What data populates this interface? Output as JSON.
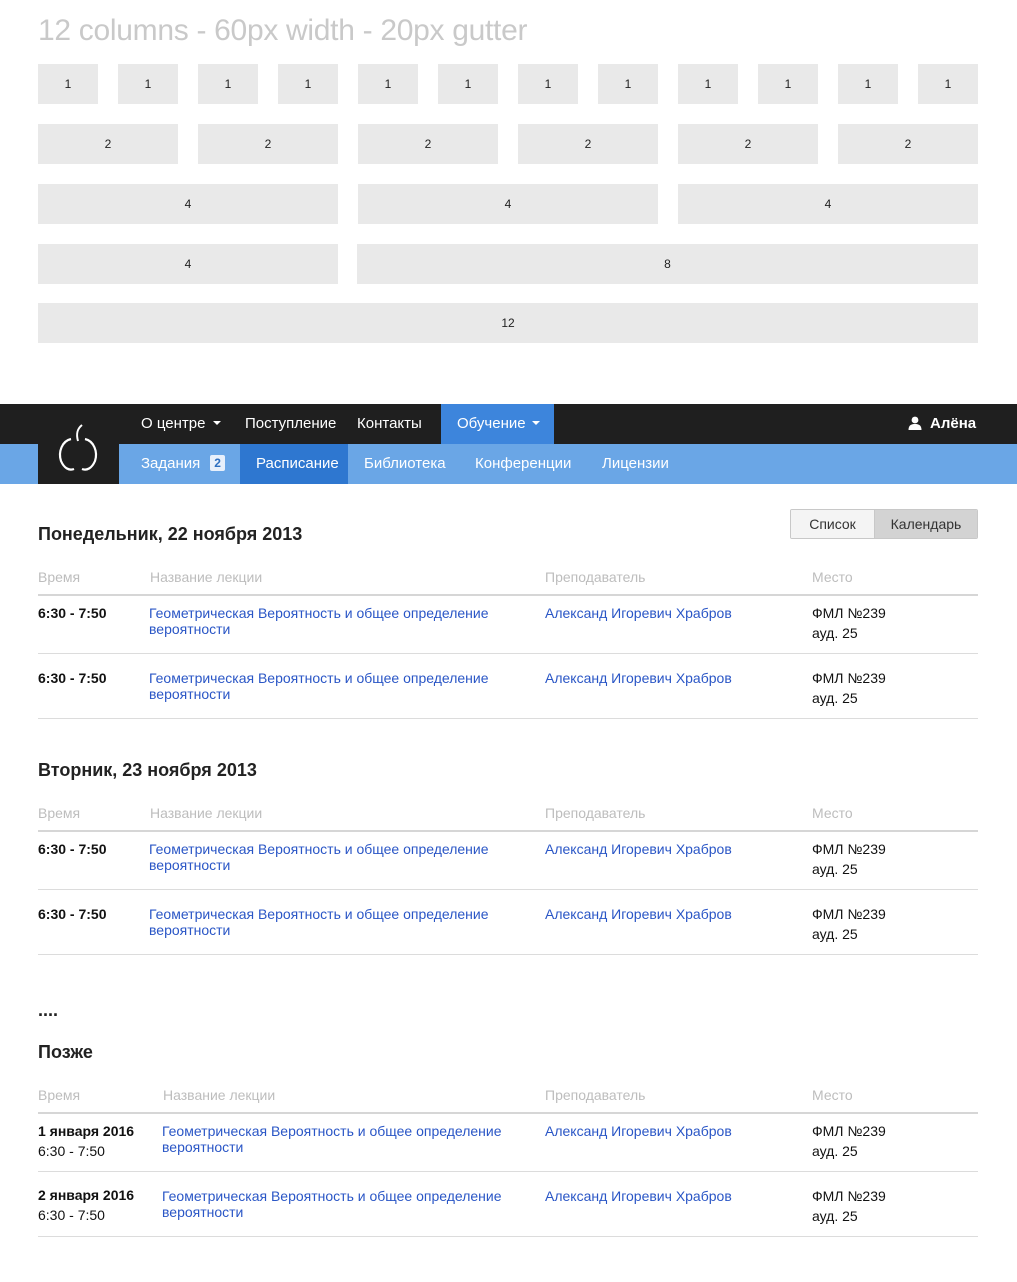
{
  "grid": {
    "title": "12 columns - 60px width - 20px gutter",
    "rows": [
      [
        "1",
        "1",
        "1",
        "1",
        "1",
        "1",
        "1",
        "1",
        "1",
        "1",
        "1",
        "1"
      ],
      [
        "2",
        "2",
        "2",
        "2",
        "2",
        "2"
      ],
      [
        "4",
        "4",
        "4"
      ],
      [
        "4",
        "8"
      ],
      [
        "12"
      ]
    ]
  },
  "nav": {
    "top": [
      "О центре",
      "Поступление",
      "Контакты",
      "Обучение"
    ],
    "user": "Алёна",
    "sub": [
      "Задания",
      "Расписание",
      "Библиотека",
      "Конференции",
      "Лицензии"
    ],
    "badge": "2",
    "colors": {
      "top_bg": "#1f1f1f",
      "sub_bg": "#6aa6e6",
      "active": "#3d85dc"
    }
  },
  "view": {
    "list": "Список",
    "calendar": "Календарь"
  },
  "columns": {
    "time": "Время",
    "lecture": "Название лекции",
    "teacher": "Преподаватель",
    "place": "Место"
  },
  "sections": [
    {
      "title": "Понедельник, 22 ноября 2013",
      "rows": [
        {
          "time": "6:30 - 7:50",
          "lecture": "Геометрическая Вероятность и общее определение вероятности",
          "teacher": "Александ Игоревич Храбров",
          "place1": "ФМЛ №239",
          "place2": "ауд. 25"
        },
        {
          "time": "6:30 - 7:50",
          "lecture": "Геометрическая Вероятность и общее  определение вероятности",
          "teacher": "Александ Игоревич Храбров",
          "place1": "ФМЛ №239",
          "place2": "ауд. 25"
        }
      ]
    },
    {
      "title": "Вторник, 23 ноября 2013",
      "rows": [
        {
          "time": "6:30 - 7:50",
          "lecture": "Геометрическая Вероятность и общее определение вероятности",
          "teacher": "Александ Игоревич Храбров",
          "place1": "ФМЛ №239",
          "place2": "ауд. 25"
        },
        {
          "time": "6:30 - 7:50",
          "lecture": "Геометрическая Вероятность и общее  определение вероятности",
          "teacher": "Александ Игоревич Храбров",
          "place1": "ФМЛ №239",
          "place2": "ауд. 25"
        }
      ]
    },
    {
      "title": "Позже",
      "rows": [
        {
          "date": "1 января 2016",
          "time": "6:30 - 7:50",
          "lecture": "Геометрическая Вероятность и общее определение вероятности",
          "teacher": "Александ Игоревич Храбров",
          "place1": "ФМЛ №239",
          "place2": "ауд. 25"
        },
        {
          "date": "2 января 2016",
          "time": "6:30 - 7:50",
          "lecture": "Геометрическая Вероятность и общее  определение вероятности",
          "teacher": "Александ Игоревич Храбров",
          "place1": "ФМЛ №239",
          "place2": "ауд. 25"
        }
      ]
    }
  ],
  "ellipsis": "...."
}
